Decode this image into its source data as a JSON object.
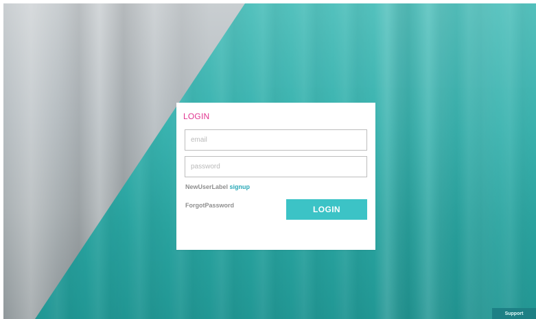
{
  "login": {
    "title": "LOGIN",
    "email_placeholder": "email",
    "password_placeholder": "password",
    "new_user_label": "NewUserLabel",
    "signup_link": "signup",
    "forgot_password": "ForgotPassword",
    "button_label": "LOGIN"
  },
  "footer": {
    "support_label": "Support"
  },
  "colors": {
    "teal_overlay": "#34b2ae",
    "title_pink": "#e0338f",
    "button_teal": "#3cc3c6",
    "link_teal": "#2aa9b8",
    "support_bg": "#1d7f84"
  }
}
